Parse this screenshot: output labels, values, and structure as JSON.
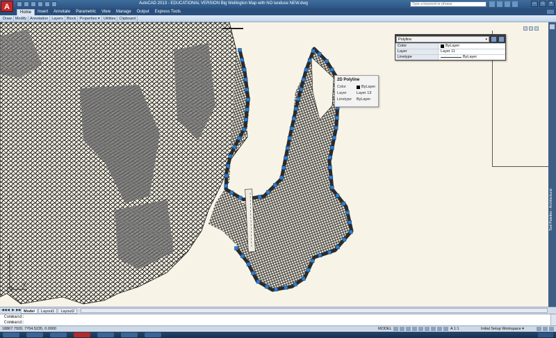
{
  "app": {
    "logo_letter": "A",
    "window_title": "AutoCAD 2013 - EDUCATIONAL VERSION    Big Wellington Map with NO landuse NEW.dwg",
    "search_placeholder": "Type a keyword or phrase"
  },
  "ribbon": {
    "tabs": [
      "Home",
      "Insert",
      "Annotate",
      "Parametric",
      "View",
      "Manage",
      "Output",
      "Express Tools"
    ],
    "active_tab": "Home",
    "panels": [
      "Draw",
      "Modify",
      "Annotation",
      "Layers",
      "Block",
      "Properties ▾",
      "Utilities",
      "Clipboard"
    ]
  },
  "properties_palette": {
    "object_type": "Polyline",
    "rows": [
      {
        "label": "Color",
        "value": "ByLayer",
        "kind": "color"
      },
      {
        "label": "Layer",
        "value": "Layer 11",
        "kind": "text"
      },
      {
        "label": "Linetype",
        "value": "ByLayer",
        "kind": "linetype"
      }
    ]
  },
  "tooltip": {
    "title": "2D Polyline",
    "rows": [
      {
        "label": "Color",
        "value": "ByLayer",
        "kind": "color"
      },
      {
        "label": "Layer",
        "value": "Layer 13",
        "kind": "text"
      },
      {
        "label": "Linetype",
        "value": "ByLayer",
        "kind": "text"
      }
    ]
  },
  "tool_palettes": {
    "label": "Tool Palettes - Architectural"
  },
  "ucs": {
    "x_label": "X",
    "y_label": "Y"
  },
  "layout_tabs": {
    "nav": [
      "◀◀",
      "◀",
      "▶",
      "▶▶"
    ],
    "tabs": [
      "Model",
      "Layout1",
      "Layout2"
    ],
    "active": "Model"
  },
  "command_line": {
    "lines": [
      "Command:",
      "Command:"
    ]
  },
  "status_bar": {
    "coords": "18867.7920, 7704.5235, 0.0000",
    "model_label": "MODEL",
    "annotation_scale": "A 1:1",
    "workspace": "Initial Setup Workspace ▾"
  },
  "colors": {
    "canvas_bg": "#f7f3e6",
    "boundary": "#2b2b2b",
    "grip": "#2f7fd0",
    "dense_fill": "#6e6e6e"
  }
}
